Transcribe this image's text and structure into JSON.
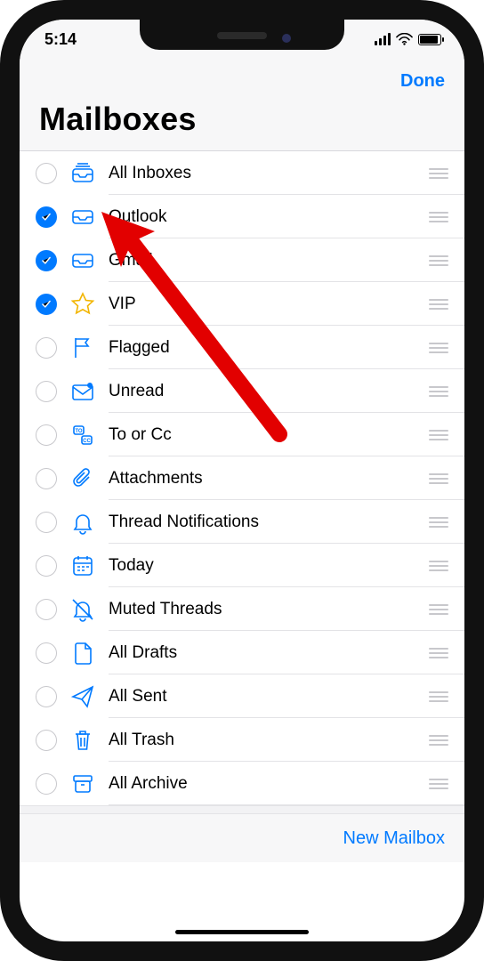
{
  "status": {
    "time": "5:14"
  },
  "nav": {
    "done": "Done",
    "title": "Mailboxes"
  },
  "footer": {
    "newMailbox": "New Mailbox"
  },
  "mailboxes": [
    {
      "id": "all-inboxes",
      "label": "All Inboxes",
      "checked": false,
      "icon": "tray-stack"
    },
    {
      "id": "outlook",
      "label": "Outlook",
      "checked": true,
      "icon": "tray"
    },
    {
      "id": "gmail",
      "label": "Gmail",
      "checked": true,
      "icon": "tray"
    },
    {
      "id": "vip",
      "label": "VIP",
      "checked": true,
      "icon": "star"
    },
    {
      "id": "flagged",
      "label": "Flagged",
      "checked": false,
      "icon": "flag"
    },
    {
      "id": "unread",
      "label": "Unread",
      "checked": false,
      "icon": "envelope-dot"
    },
    {
      "id": "to-or-cc",
      "label": "To or Cc",
      "checked": false,
      "icon": "to-cc"
    },
    {
      "id": "attachments",
      "label": "Attachments",
      "checked": false,
      "icon": "paperclip"
    },
    {
      "id": "thread-notif",
      "label": "Thread Notifications",
      "checked": false,
      "icon": "bell"
    },
    {
      "id": "today",
      "label": "Today",
      "checked": false,
      "icon": "calendar"
    },
    {
      "id": "muted",
      "label": "Muted Threads",
      "checked": false,
      "icon": "bell-slash"
    },
    {
      "id": "all-drafts",
      "label": "All Drafts",
      "checked": false,
      "icon": "doc"
    },
    {
      "id": "all-sent",
      "label": "All Sent",
      "checked": false,
      "icon": "paperplane"
    },
    {
      "id": "all-trash",
      "label": "All Trash",
      "checked": false,
      "icon": "trash"
    },
    {
      "id": "all-archive",
      "label": "All Archive",
      "checked": false,
      "icon": "archive"
    }
  ]
}
